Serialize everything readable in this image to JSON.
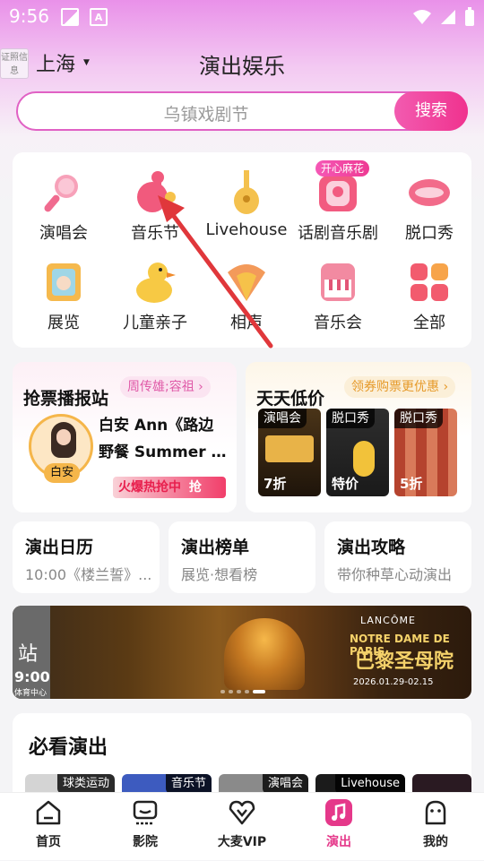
{
  "status_bar": {
    "time": "9:56",
    "icon_a_label": "A"
  },
  "header": {
    "license_badge": "证照信息",
    "city": "上海",
    "title": "演出娱乐"
  },
  "search": {
    "placeholder": "乌镇戏剧节",
    "button_label": "搜索"
  },
  "categories": {
    "badge": "开心麻花",
    "items": [
      {
        "label": "演唱会",
        "icon": "microphone-icon",
        "color": "#f7a1b9"
      },
      {
        "label": "音乐节",
        "icon": "duck-guitar-icon",
        "color": "#f15a7d"
      },
      {
        "label": "Livehouse",
        "icon": "guitar-icon",
        "color": "#f4c14e"
      },
      {
        "label": "话剧音乐剧",
        "icon": "theater-mask-icon",
        "color": "#f25b80"
      },
      {
        "label": "脱口秀",
        "icon": "lips-icon",
        "color": "#f26b8a"
      },
      {
        "label": "展览",
        "icon": "painting-icon",
        "color": "#f5b94d"
      },
      {
        "label": "儿童亲子",
        "icon": "rubber-duck-icon",
        "color": "#f7c944"
      },
      {
        "label": "相声",
        "icon": "fan-icon",
        "color": "#f39a5a"
      },
      {
        "label": "音乐会",
        "icon": "piano-icon",
        "color": "#f28aa1"
      },
      {
        "label": "全部",
        "icon": "grid-icon",
        "color": "#f25b6e"
      }
    ]
  },
  "ticket_news": {
    "title": "抢票播报站",
    "chip": "周传雄;容祖",
    "avatar_name": "白安",
    "line1": "白安 Ann《路边",
    "line2": "野餐 Summer Tr...",
    "hot_label": "火爆热抢中",
    "hot_icon": "抢"
  },
  "daily_deals": {
    "title": "天天低价",
    "chip": "领券购票更优惠",
    "items": [
      {
        "tag": "演唱会",
        "price": "7折",
        "color": "#3a2a12"
      },
      {
        "tag": "脱口秀",
        "price": "特价",
        "color": "#2a2a2a"
      },
      {
        "tag": "脱口秀",
        "price": "5折",
        "color": "#b5432e"
      }
    ]
  },
  "quick_cards": [
    {
      "title": "演出日历",
      "subtitle": "10:00《楼兰誓》..."
    },
    {
      "title": "演出榜单",
      "subtitle": "展览·想看榜"
    },
    {
      "title": "演出攻略",
      "subtitle": "带你种草心动演出"
    }
  ],
  "banner": {
    "left_char": "站",
    "left_time": "9:00",
    "left_venue": "体育中心",
    "brand": "LANCÔME",
    "en_title": "NOTRE DAME DE PARIS",
    "cn_title": "巴黎圣母院",
    "date": "2026.01.29-02.15"
  },
  "must_see": {
    "title": "必看演出",
    "items": [
      {
        "tag": "球类运动",
        "color": "#cfcfcf"
      },
      {
        "tag": "音乐节",
        "color": "#3d5bbf"
      },
      {
        "tag": "演唱会",
        "color": "#8a8a8a"
      },
      {
        "tag": "Livehouse",
        "color": "#1b1b1b"
      }
    ]
  },
  "tabbar": [
    {
      "label": "首页",
      "icon": "home-icon"
    },
    {
      "label": "影院",
      "icon": "cinema-icon"
    },
    {
      "label": "大麦VIP",
      "icon": "vip-heart-icon"
    },
    {
      "label": "演出",
      "icon": "music-note-icon",
      "active": true
    },
    {
      "label": "我的",
      "icon": "profile-icon"
    }
  ],
  "colors": {
    "accent": "#e5388a",
    "search_border": "#e061c4"
  }
}
